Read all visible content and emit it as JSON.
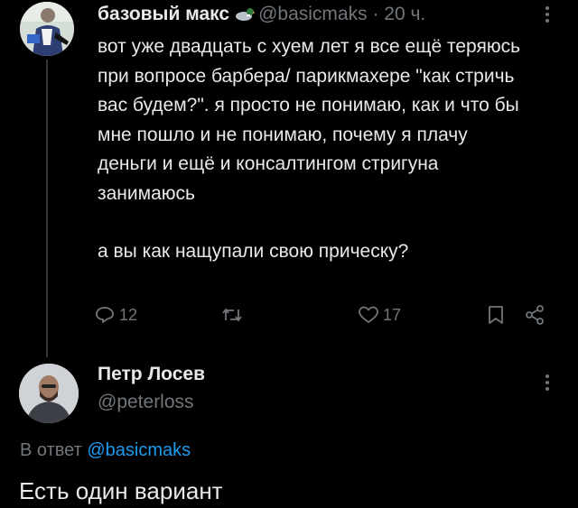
{
  "tweet1": {
    "author_name": "базовый макс",
    "author_emoji": "duck-emoji",
    "handle": "@basicmaks",
    "separator": "·",
    "time": "20 ч.",
    "paragraphs": [
      "вот уже двадцать с хуем лет я все ещё теряюсь при вопросе барбера/ парикмахере \"как стричь вас будем?\". я просто не понимаю, как и что бы мне пошло и не понимаю, почему я плачу деньги и ещё и консалтингом стригуна занимаюсь",
      "а вы как нащупали свою прическу?"
    ],
    "actions": {
      "reply_count": "12",
      "retweet_count": "",
      "like_count": "17"
    }
  },
  "tweet2": {
    "author_name": "Петр Лосев",
    "handle": "@peterloss",
    "replying_prefix": "В ответ",
    "replying_to": "@basicmaks",
    "text": "Есть один вариант"
  },
  "colors": {
    "background": "#000000",
    "text": "#e7e9ea",
    "muted": "#71767b",
    "link": "#1d9bf0",
    "thread_line": "#333639"
  },
  "icons": [
    "more-icon",
    "reply-icon",
    "retweet-icon",
    "like-icon",
    "bookmark-icon",
    "share-icon",
    "duck-emoji"
  ]
}
